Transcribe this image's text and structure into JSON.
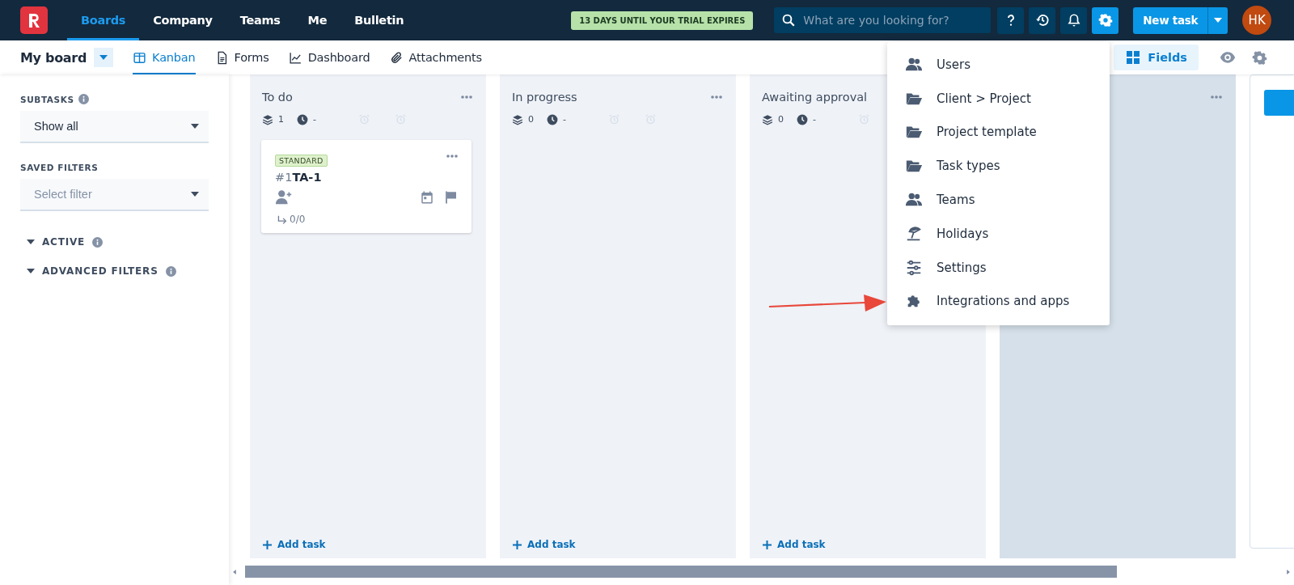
{
  "topbar": {
    "nav": [
      {
        "label": "Boards",
        "selected": true
      },
      {
        "label": "Company",
        "selected": false
      },
      {
        "label": "Teams",
        "selected": false
      },
      {
        "label": "Me",
        "selected": false
      },
      {
        "label": "Bulletin",
        "selected": false
      }
    ],
    "trial_badge": "13 DAYS UNTIL YOUR TRIAL EXPIRES",
    "search": {
      "placeholder": "What are you looking for?"
    },
    "icon_buttons": [
      {
        "kind": "help",
        "selected": false
      },
      {
        "kind": "history",
        "selected": false
      },
      {
        "kind": "bell",
        "selected": false
      },
      {
        "kind": "settings",
        "selected": true
      }
    ],
    "new_task_button": "New task",
    "avatar": "HK"
  },
  "subbar": {
    "board_title": "My board",
    "views": [
      {
        "label": "Kanban",
        "kind": "kanban",
        "selected": true
      },
      {
        "label": "Forms",
        "kind": "forms",
        "selected": false
      },
      {
        "label": "Dashboard",
        "kind": "dashboard",
        "selected": false
      },
      {
        "label": "Attachments",
        "kind": "attachments",
        "selected": false
      }
    ],
    "fields_button": "Fields"
  },
  "sidebar": {
    "subtasks": {
      "label": "SUBTASKS",
      "value": "Show all"
    },
    "saved_filters": {
      "label": "SAVED FILTERS",
      "placeholder": "Select filter"
    },
    "sections": [
      {
        "label": "ACTIVE",
        "expanded": true
      },
      {
        "label": "ADVANCED FILTERS",
        "expanded": true
      }
    ]
  },
  "columns": [
    {
      "kind": "list",
      "title": "To do",
      "task_count": "1",
      "time": "-",
      "add_label": "Add task",
      "cards": [
        {
          "tag": "STANDARD",
          "number": "#1",
          "key": "TA-1",
          "subtasks": "0/0"
        }
      ]
    },
    {
      "kind": "list",
      "title": "In progress",
      "task_count": "0",
      "time": "-",
      "add_label": "Add task"
    },
    {
      "kind": "list",
      "title": "Awaiting approval",
      "task_count": "0",
      "time": "-",
      "add_label": "Add task"
    },
    {
      "kind": "covered"
    },
    {
      "kind": "new"
    }
  ],
  "settings_menu": [
    {
      "kind": "users",
      "label": "Users"
    },
    {
      "kind": "folder",
      "label": "Client > Project"
    },
    {
      "kind": "folder",
      "label": "Project template"
    },
    {
      "kind": "folder",
      "label": "Task types"
    },
    {
      "kind": "users",
      "label": "Teams"
    },
    {
      "kind": "beach",
      "label": "Holidays"
    },
    {
      "kind": "sliders",
      "label": "Settings"
    },
    {
      "kind": "puzzle",
      "label": "Integrations and apps"
    }
  ]
}
